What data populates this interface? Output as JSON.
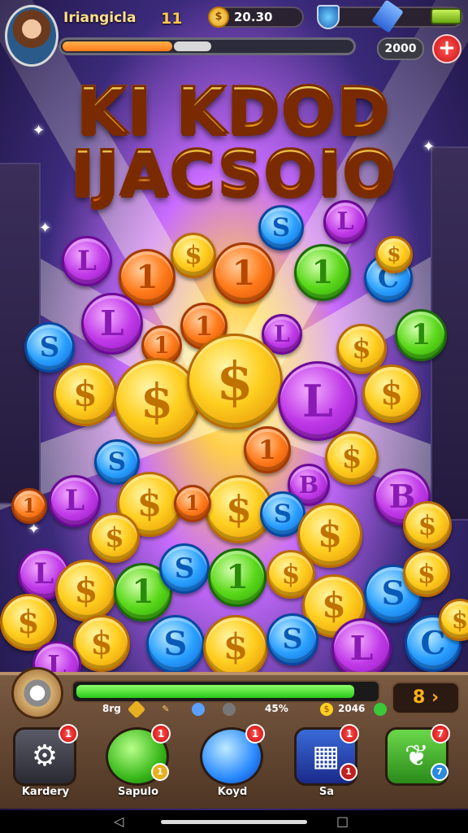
{
  "player": {
    "name": "Iriangicla",
    "level": "11"
  },
  "resources": {
    "coins": "20.30",
    "gems": "2000"
  },
  "xp": {
    "progress": 0.54
  },
  "title": {
    "line1": "KI KDOD",
    "line2": "IJACSOIO"
  },
  "coins_pile": [
    {
      "label": "$",
      "color": "gold"
    },
    {
      "label": "1",
      "color": "orange"
    },
    {
      "label": "L",
      "color": "purple"
    },
    {
      "label": "S",
      "color": "blue"
    },
    {
      "label": "1",
      "color": "green"
    },
    {
      "label": "B",
      "color": "purple"
    },
    {
      "label": "C",
      "color": "blue"
    }
  ],
  "bottom": {
    "progress": 0.93,
    "multiplier": "8",
    "stats": {
      "left": "8rg",
      "mid": "45%",
      "right": "2046"
    },
    "buttons": [
      {
        "label": "Kardery",
        "badge": "1",
        "icon": "wrench-icon"
      },
      {
        "label": "Sapulo",
        "badge": "1",
        "icon": "green-orb-icon",
        "sub": "1"
      },
      {
        "label": "Koyd",
        "badge": "1",
        "icon": "blue-orb-icon"
      },
      {
        "label": "Sa",
        "badge": "1",
        "icon": "treasure-sign-icon",
        "sub": "1"
      },
      {
        "label": "",
        "badge": "7",
        "icon": "leaf-icon",
        "sub": "7"
      }
    ]
  },
  "colors": {
    "accent": "#ffcf20",
    "danger": "#d01010",
    "progress": "#2ac81a"
  }
}
